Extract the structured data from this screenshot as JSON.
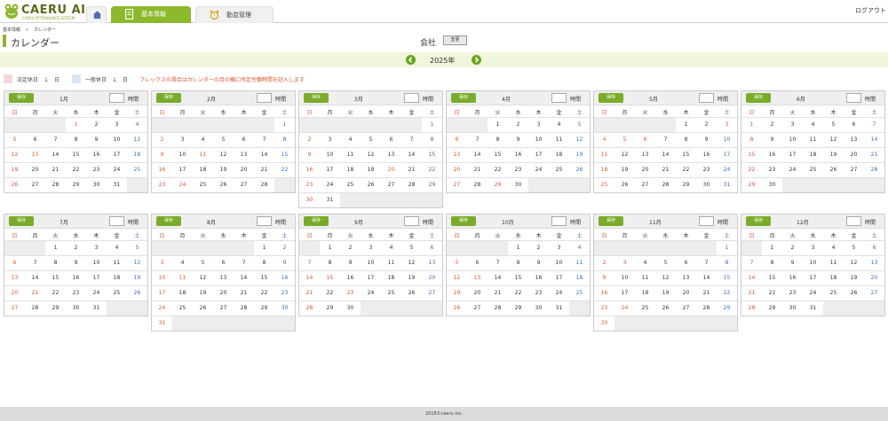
{
  "app": {
    "logo_text": "CAERU AI",
    "logo_sub": "CAERU ATTENDANCE SYSTEM",
    "logout": "ログアウト",
    "tabs": [
      {
        "label": "基本情報",
        "icon": "document-icon",
        "active": true
      },
      {
        "label": "勤怠管理",
        "icon": "alarm-clock-icon",
        "active": false
      }
    ]
  },
  "breadcrumb": [
    "基本情報",
    "»",
    "カレンダー"
  ],
  "page": {
    "title": "カレンダー",
    "company_label": "会社",
    "change_button": "変更"
  },
  "year": "2025年",
  "legend": {
    "holiday_fixed": "法定休日　１　日",
    "holiday_general": "一般休日　１　日",
    "note": "フレックスの場合はカレンダーの月の横に所定労働時間を記入します"
  },
  "calendar": {
    "save_label": "保存",
    "hours_label": "時間",
    "weekdays": [
      "日",
      "月",
      "火",
      "水",
      "木",
      "金",
      "土"
    ],
    "months": [
      {
        "label": "1月",
        "start": 3,
        "days": 31,
        "holidays": [
          1,
          13
        ]
      },
      {
        "label": "2月",
        "start": 6,
        "days": 28,
        "holidays": [
          11,
          24
        ]
      },
      {
        "label": "3月",
        "start": 6,
        "days": 31,
        "holidays": [
          20
        ]
      },
      {
        "label": "4月",
        "start": 2,
        "days": 30,
        "holidays": [
          29
        ]
      },
      {
        "label": "5月",
        "start": 4,
        "days": 31,
        "holidays": [
          3,
          5,
          6
        ]
      },
      {
        "label": "6月",
        "start": 0,
        "days": 30,
        "holidays": []
      },
      {
        "label": "7月",
        "start": 2,
        "days": 31,
        "holidays": [
          21
        ]
      },
      {
        "label": "8月",
        "start": 5,
        "days": 31,
        "holidays": [
          11
        ]
      },
      {
        "label": "9月",
        "start": 1,
        "days": 30,
        "holidays": [
          15,
          23
        ]
      },
      {
        "label": "10月",
        "start": 3,
        "days": 31,
        "holidays": [
          13
        ]
      },
      {
        "label": "11月",
        "start": 6,
        "days": 30,
        "holidays": [
          3,
          24
        ]
      },
      {
        "label": "12月",
        "start": 1,
        "days": 31,
        "holidays": []
      }
    ]
  },
  "footer": "2018©caeru inc.",
  "colors": {
    "accent": "#8cb82c",
    "sunday": "#e0562e",
    "saturday": "#3a6fb6",
    "yearbar": "#f0f5dc"
  }
}
